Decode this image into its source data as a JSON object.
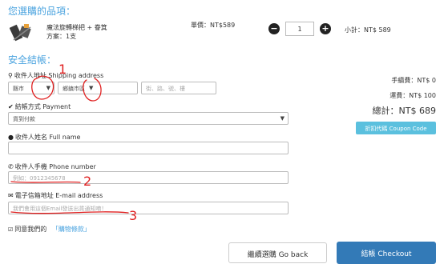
{
  "section1_title": "您選購的品項：",
  "product": {
    "name": "魔法旋轉梯把 + 眷箕",
    "plan": "方案：1支",
    "unit_price": "單價：NT$589",
    "quantity": "1",
    "subtotal": "小計：NT$ 589",
    "minus": "−",
    "plus": "+"
  },
  "section2_title": "安全結帳：",
  "shipping": {
    "label": "收件人地址 Shipping address",
    "county": "縣市",
    "district": "鄉鎮市區",
    "street_placeholder": "街、路、號、樓"
  },
  "payment": {
    "label": "結帳方式 Payment",
    "value": "貨到付款"
  },
  "name_field": {
    "label": "收件人姓名 Full name"
  },
  "phone": {
    "label": "收件人手機 Phone number",
    "placeholder": "例如：0912345678"
  },
  "email": {
    "label": "電子信箱地址 E-mail address",
    "placeholder": "我們會用這個Email發送出貨通知唷！"
  },
  "agree": {
    "prefix": "同意我們的",
    "link": "「購物條款」"
  },
  "summary": {
    "shipping_fee": "手續費：NT$ 0",
    "delivery": "運費：NT$ 100",
    "total": "總計：NT$ 689",
    "coupon_button": "折扣代碼 Coupon Code"
  },
  "buttons": {
    "back": "繼續選購 Go back",
    "checkout": "結帳 Checkout"
  },
  "annotations": [
    "1",
    "2",
    "3"
  ],
  "colors": {
    "accent": "#4aa3df",
    "checkout": "#337ab7",
    "coupon": "#5bc0de",
    "annotation": "#e02020"
  }
}
